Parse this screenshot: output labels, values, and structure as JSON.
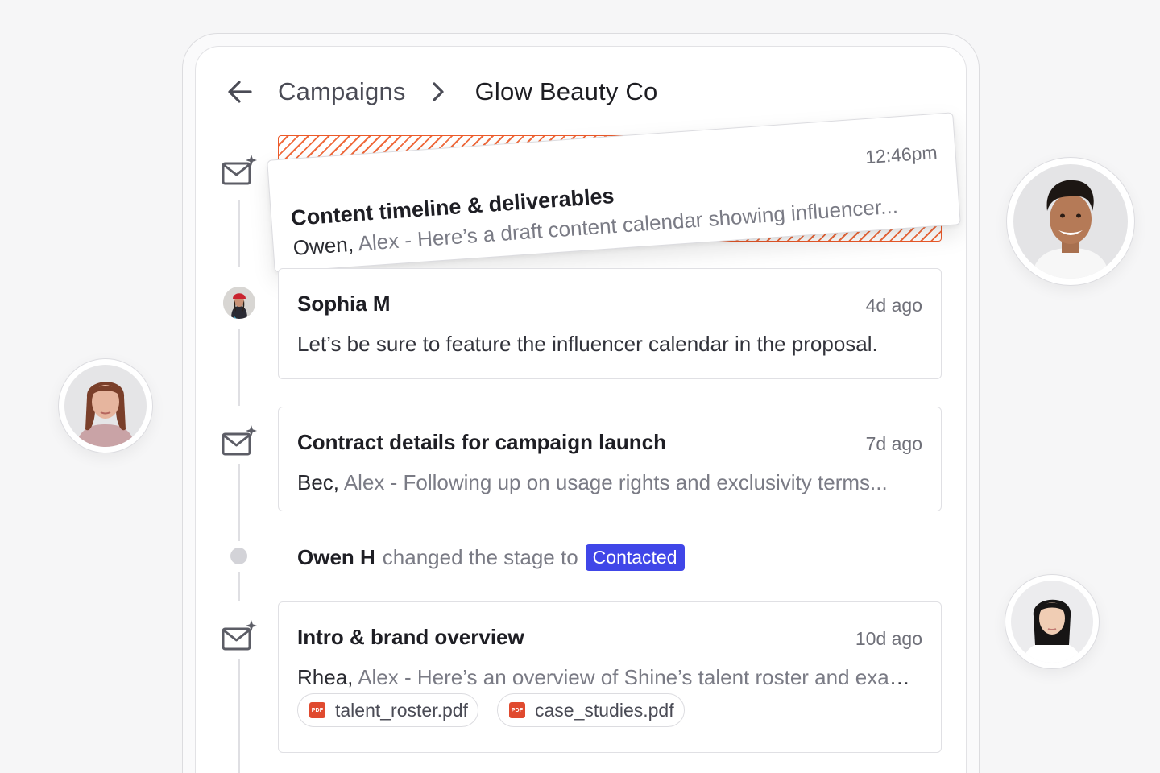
{
  "breadcrumb": {
    "back_icon": "arrow-left-icon",
    "parent": "Campaigns",
    "separator_icon": "chevron-right-icon",
    "current": "Glow Beauty Co"
  },
  "timeline": {
    "dragged_email": {
      "icon": "mail-sparkle-icon",
      "title": "Content timeline & deliverables",
      "time": "12:46pm",
      "from": "Owen,",
      "cc": "Alex",
      "preview": "- Here’s a draft content calendar showing influencer..."
    },
    "comment": {
      "author": "Sophia M",
      "time": "4d ago",
      "text": "Let’s be sure to feature the influencer calendar in the proposal."
    },
    "email_contract": {
      "icon": "mail-sparkle-icon",
      "title": "Contract details for campaign launch",
      "time": "7d ago",
      "from": "Bec,",
      "cc": "Alex",
      "preview": "- Following up on usage rights and exclusivity terms..."
    },
    "stage_change": {
      "actor": "Owen H",
      "action": "changed the stage to",
      "stage": "Contacted",
      "stage_color": "#4046e8"
    },
    "email_intro": {
      "icon": "mail-sparkle-icon",
      "title": "Intro & brand overview",
      "time": "10d ago",
      "from": "Rhea,",
      "cc": "Alex",
      "preview": "- Here’s an overview of Shine’s talent roster and examples",
      "attachments": [
        {
          "name": "talent_roster.pdf",
          "icon": "pdf-icon"
        },
        {
          "name": "case_studies.pdf",
          "icon": "pdf-icon"
        }
      ]
    }
  },
  "colors": {
    "accent": "#4046e8",
    "drop_target": "#ec5a2a",
    "pdf": "#e04a2f"
  }
}
